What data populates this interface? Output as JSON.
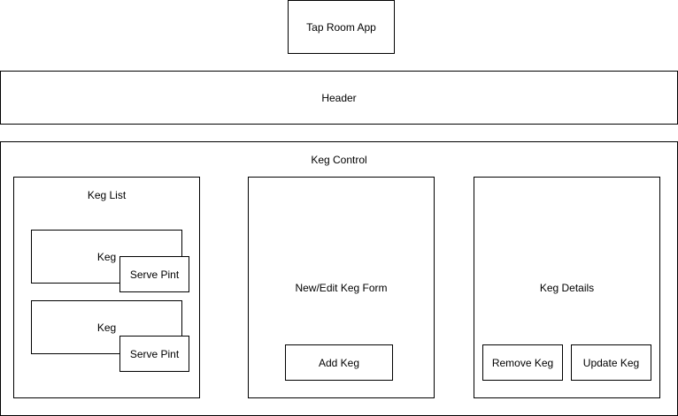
{
  "app": {
    "title": "Tap Room App"
  },
  "header": {
    "label": "Header"
  },
  "keg_control": {
    "label": "Keg Control",
    "keg_list": {
      "label": "Keg List",
      "kegs": [
        {
          "label": "Keg",
          "serve_button": "Serve Pint"
        },
        {
          "label": "Keg",
          "serve_button": "Serve Pint"
        }
      ]
    },
    "keg_form": {
      "label": "New/Edit Keg Form",
      "add_button": "Add Keg"
    },
    "keg_details": {
      "label": "Keg Details",
      "remove_button": "Remove Keg",
      "update_button": "Update Keg"
    }
  }
}
